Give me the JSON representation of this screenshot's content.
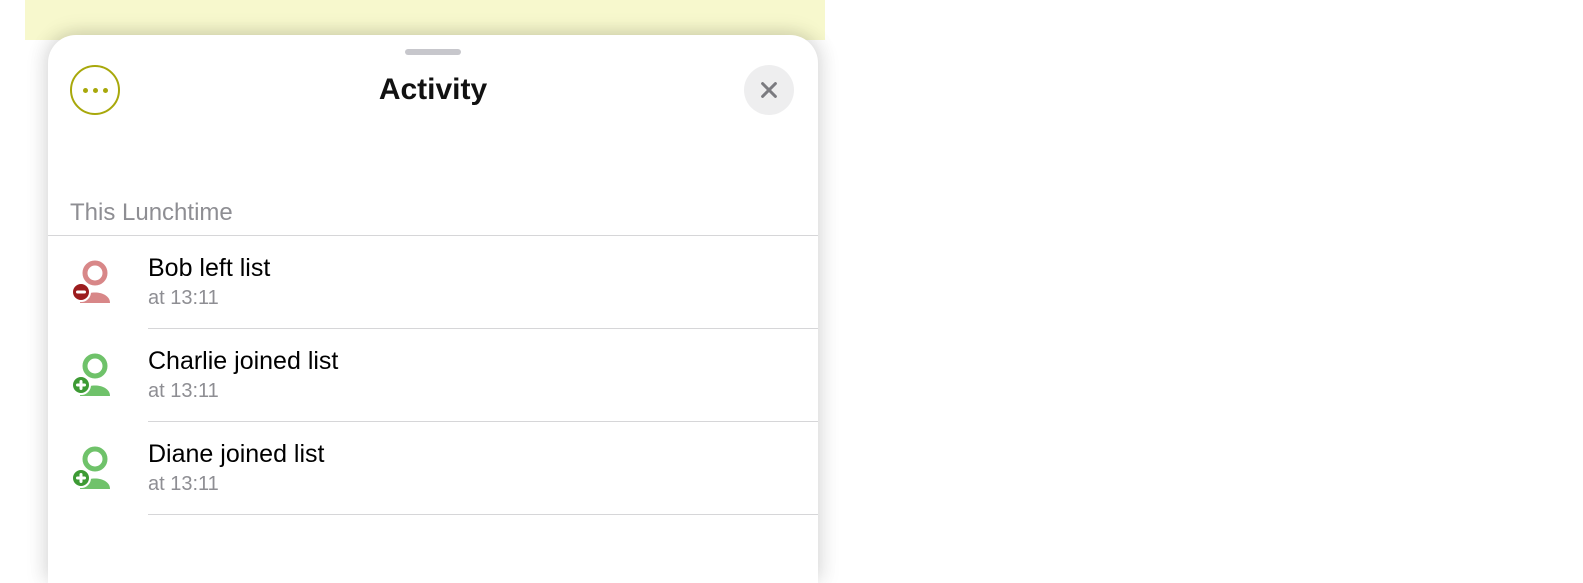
{
  "header": {
    "title": "Activity"
  },
  "section": {
    "label": "This Lunchtime"
  },
  "events": [
    {
      "type": "left",
      "title": "Bob left list",
      "time": "at 13:11"
    },
    {
      "type": "joined",
      "title": "Charlie joined list",
      "time": "at 13:11"
    },
    {
      "type": "joined",
      "title": "Diane joined list",
      "time": "at 13:11"
    }
  ],
  "colors": {
    "accent_olive": "#a8a80b",
    "left_red": "#d88788",
    "left_red_dark": "#9c1c1e",
    "joined_green": "#6fc26a",
    "joined_green_dark": "#3d9a34"
  }
}
